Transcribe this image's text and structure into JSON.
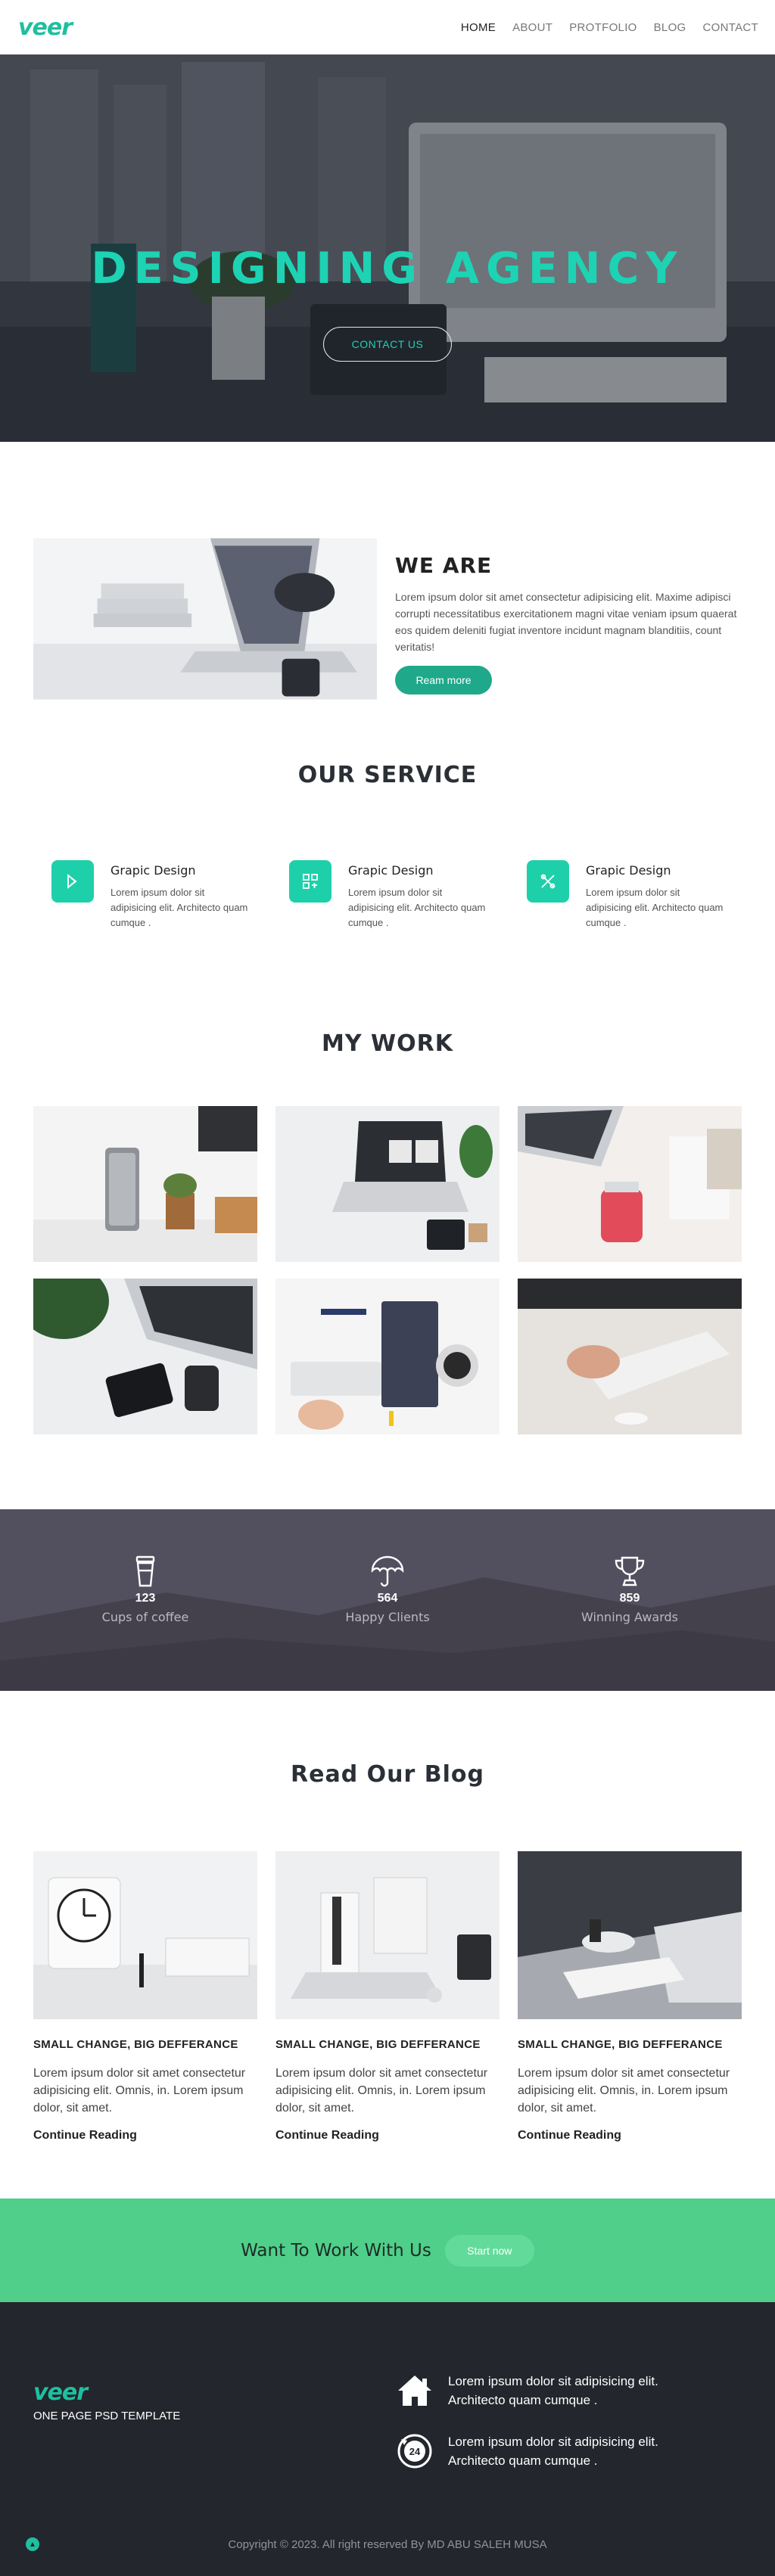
{
  "brand": {
    "logo": "veer",
    "accent": "#1dd3b3",
    "green": "#4fcf89",
    "dark": "#23262c"
  },
  "nav": {
    "items": [
      "HOME",
      "ABOUT",
      "PROTFOLIO",
      "BLOG",
      "CONTACT"
    ],
    "active": "HOME"
  },
  "hero": {
    "title": "DESIGNING AGENCY",
    "button": "CONTACT US"
  },
  "about": {
    "title": "WE ARE",
    "body": "Lorem ipsum dolor sit amet consectetur adipisicing elit. Maxime adipisci corrupti necessitatibus exercitationem magni vitae veniam ipsum quaerat eos quidem deleniti fugiat inventore incidunt magnam blanditiis, count veritatis!",
    "button": "Ream more"
  },
  "services": {
    "title": "OUR SERVICE",
    "items": [
      {
        "icon": "design-icon",
        "title": "Grapic Design",
        "desc": "Lorem ipsum dolor sit adipisicing elit. Architecto quam cumque ."
      },
      {
        "icon": "layout-icon",
        "title": "Grapic Design",
        "desc": "Lorem ipsum dolor sit adipisicing elit. Architecto quam cumque ."
      },
      {
        "icon": "tools-icon",
        "title": "Grapic Design",
        "desc": "Lorem ipsum dolor sit adipisicing elit. Architecto quam cumque ."
      }
    ]
  },
  "work": {
    "title": "MY WORK",
    "count": 6
  },
  "stats": [
    {
      "icon": "coffee-cup-icon",
      "value": "123",
      "label": "Cups of coffee"
    },
    {
      "icon": "umbrella-icon",
      "value": "564",
      "label": "Happy Clients"
    },
    {
      "icon": "trophy-icon",
      "value": "859",
      "label": "Winning Awards"
    }
  ],
  "blog": {
    "title": "Read Our Blog",
    "posts": [
      {
        "title": "SMALL CHANGE, BIG DEFFERANCE",
        "body": "Lorem ipsum dolor sit amet consectetur adipisicing elit. Omnis, in. Lorem ipsum dolor, sit amet.",
        "link": "Continue Reading"
      },
      {
        "title": "SMALL CHANGE, BIG DEFFERANCE",
        "body": "Lorem ipsum dolor sit amet consectetur adipisicing elit. Omnis, in. Lorem ipsum dolor, sit amet.",
        "link": "Continue Reading"
      },
      {
        "title": "SMALL CHANGE, BIG DEFFERANCE",
        "body": "Lorem ipsum dolor sit amet consectetur adipisicing elit. Omnis, in. Lorem ipsum dolor, sit amet.",
        "link": "Continue Reading"
      }
    ]
  },
  "cta": {
    "text": "Want To Work With Us",
    "button": "Start now"
  },
  "footer": {
    "logo": "veer",
    "tagline": "ONE PAGE PSD TEMPLATE",
    "items": [
      {
        "icon": "home-icon",
        "text": "Lorem ipsum dolor sit adipisicing elit. Architecto quam cumque ."
      },
      {
        "icon": "phone-24-icon",
        "text": "Lorem ipsum dolor sit adipisicing elit. Architecto quam cumque ."
      }
    ],
    "copyright": "Copyright © 2023. All right reserved By MD ABU SALEH MUSA"
  }
}
